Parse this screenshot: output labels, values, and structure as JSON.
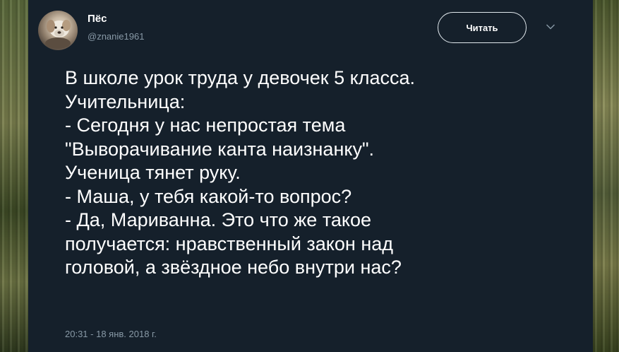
{
  "author": {
    "name": "Пёс",
    "handle": "@znanie1961"
  },
  "follow_button": {
    "label": "Читать"
  },
  "menu": {
    "icon": "chevron-down-icon"
  },
  "tweet": {
    "lines": [
      "В школе урок труда у девочек 5 класса.",
      "Учительница:",
      "- Сегодня у нас непростая тема",
      "\"Выворачивание канта наизнанку\".",
      "Ученица тянет руку.",
      "- Маша, у тебя какой-то вопрос?",
      "- Да, Мариванна. Это что же такое",
      "получается: нравственный закон над",
      "головой, а звёздное небо внутри нас?"
    ],
    "timestamp": "20:31 - 18 янв. 2018 г."
  },
  "colors": {
    "card_background": "#15202b",
    "text_primary": "#ffffff",
    "text_secondary": "#8899a6",
    "button_border": "#e1e8ed"
  }
}
